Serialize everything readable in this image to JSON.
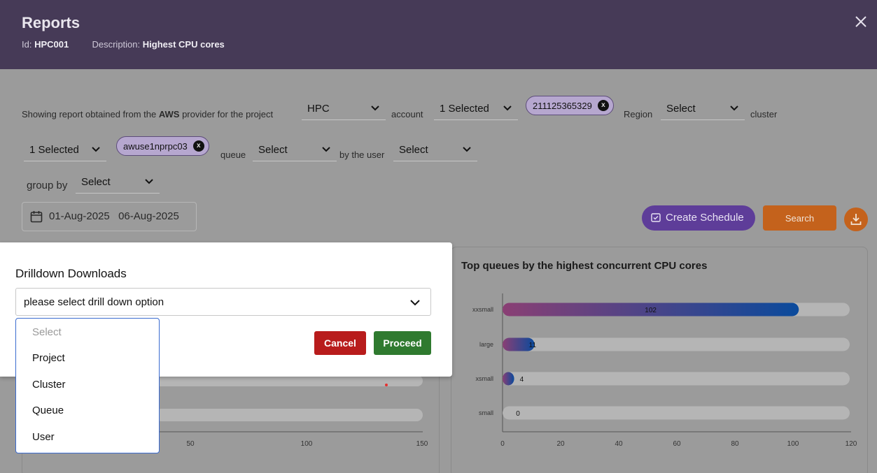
{
  "header": {
    "title": "Reports",
    "id_label": "Id:",
    "id_value": "HPC001",
    "desc_label": "Description:",
    "desc_value": "Highest CPU cores",
    "close_icon": "close-icon"
  },
  "filters": {
    "intro_text_1": "Showing report obtained from the ",
    "provider": "AWS",
    "intro_text_2": " provider for the project",
    "project_value": "HPC",
    "account_label": "account",
    "account_value": "1 Selected",
    "account_chip": "211125365329",
    "region_label": "Region",
    "region_value": "Select",
    "cluster_label": "cluster",
    "cluster_value": "1 Selected",
    "cluster_chip": "awuse1nprpc03",
    "queue_label": "queue",
    "queue_value": "Select",
    "user_label": "by the user",
    "user_value": "Select",
    "groupby_label": "group by",
    "groupby_value": "Select",
    "date_start": "01-Aug-2025",
    "date_end": "06-Aug-2025"
  },
  "actions": {
    "create_schedule": "Create Schedule",
    "search": "Search"
  },
  "left_panel": {
    "ticks": [
      "50",
      "100",
      "150"
    ]
  },
  "chart_data": {
    "type": "bar",
    "orientation": "horizontal",
    "title": "Top queues by the highest concurrent CPU cores",
    "categories": [
      "xxsmall",
      "large",
      "xsmall",
      "small"
    ],
    "values": [
      102,
      11,
      4,
      0
    ],
    "xlim": [
      0,
      120
    ],
    "xticks": [
      0,
      20,
      40,
      60,
      80,
      100,
      120
    ],
    "colors": {
      "bar_start": "#8a3f74",
      "bar_end": "#0a4a9c",
      "track": "#b5b5b5"
    }
  },
  "modal": {
    "title": "Drilldown Downloads",
    "select_value": "please select drill down option",
    "cancel": "Cancel",
    "proceed": "Proceed",
    "options": [
      "Select",
      "Project",
      "Cluster",
      "Queue",
      "User"
    ]
  }
}
